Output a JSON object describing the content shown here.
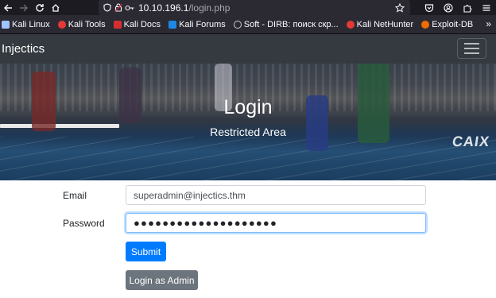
{
  "browser": {
    "url_host": "10.10.196.1",
    "url_path": "/login.php",
    "bookmarks": [
      {
        "label": "Kali Linux",
        "color": "#367bf0"
      },
      {
        "label": "Kali Tools",
        "color": "#e53935"
      },
      {
        "label": "Kali Docs",
        "color": "#d32f2f"
      },
      {
        "label": "Kali Forums",
        "color": "#1e88e5"
      },
      {
        "label": "Soft - DIRB: поиск скр...",
        "color": "#cccccc"
      },
      {
        "label": "Kali NetHunter",
        "color": "#e53935"
      },
      {
        "label": "Exploit-DB",
        "color": "#ef6c00"
      }
    ]
  },
  "site": {
    "brand": "Injectics"
  },
  "hero": {
    "title": "Login",
    "subtitle": "Restricted Area",
    "banner_text": "CAIX"
  },
  "form": {
    "email_label": "Email",
    "email_value": "superadmin@injectics.thm",
    "password_label": "Password",
    "password_value": "●●●●●●●●●●●●●●●●●●●●",
    "submit_label": "Submit",
    "admin_label": "Login as Admin"
  },
  "colors": {
    "navbar": "#343a40",
    "primary": "#007bff",
    "secondary": "#6c757d"
  }
}
